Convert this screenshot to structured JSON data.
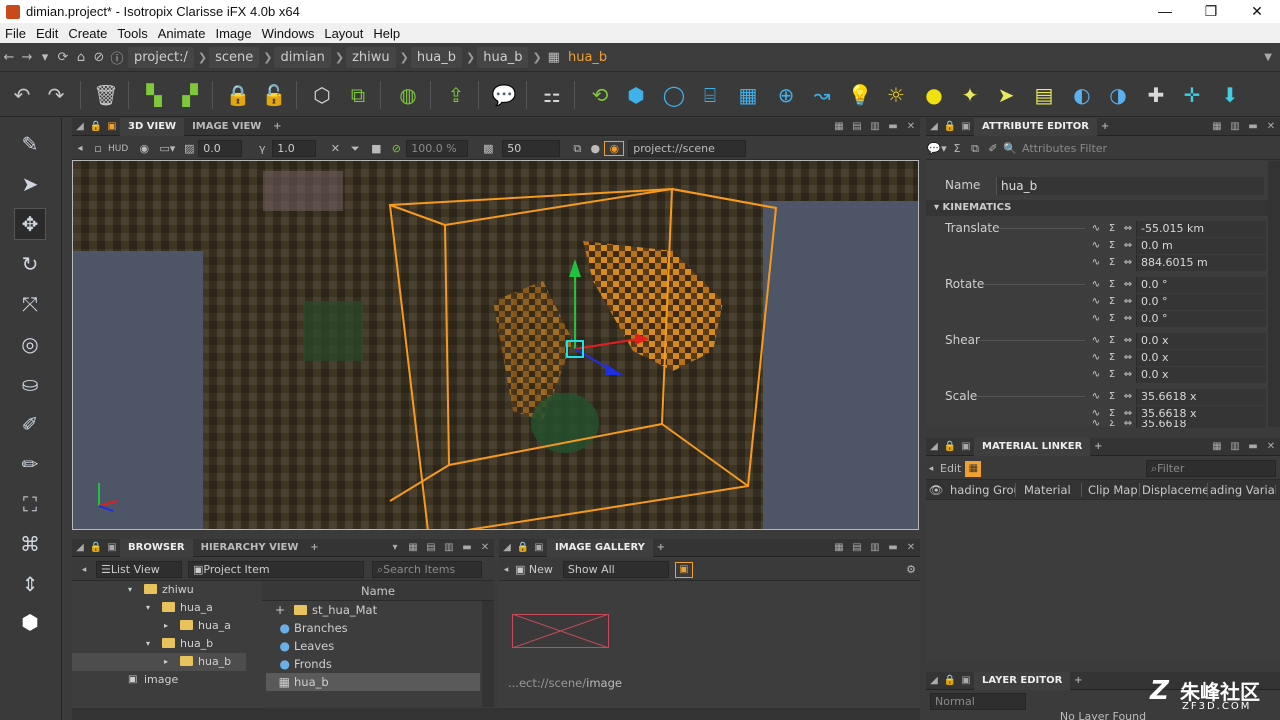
{
  "window": {
    "title": "dimian.project* - Isotropix Clarisse iFX 4.0b x64",
    "minimize": "—",
    "restore": "❐",
    "close": "✕"
  },
  "menu": [
    "File",
    "Edit",
    "Create",
    "Tools",
    "Animate",
    "Image",
    "Windows",
    "Layout",
    "Help"
  ],
  "path": {
    "crumbs": [
      "project:/",
      "scene",
      "dimian",
      "zhiwu",
      "hua_b",
      "hua_b"
    ],
    "current": "hua_b"
  },
  "viewport_panel": {
    "tabs": [
      "3D VIEW",
      "IMAGE VIEW"
    ],
    "hud_label": "HUD",
    "exposure": "0.0",
    "gamma_icon": "γ",
    "gamma": "1.0",
    "quality": "100.0 %",
    "samples": "50",
    "context": "project://scene"
  },
  "attribute_editor": {
    "tab": "ATTRIBUTE EDITOR",
    "filter_placeholder": "Attributes Filter",
    "name_label": "Name",
    "name_value": "hua_b",
    "section": "KINEMATICS",
    "translate_label": "Translate",
    "translate": [
      "-55.015 km",
      "0.0 m",
      "884.6015 m"
    ],
    "rotate_label": "Rotate",
    "rotate": [
      "0.0 °",
      "0.0 °",
      "0.0 °"
    ],
    "shear_label": "Shear",
    "shear": [
      "0.0 x",
      "0.0 x",
      "0.0 x"
    ],
    "scale_label": "Scale",
    "scale": [
      "35.6618 x",
      "35.6618 x",
      "35.6618"
    ]
  },
  "material_linker": {
    "tab": "MATERIAL LINKER",
    "edit_label": "Edit",
    "filter_placeholder": "Filter",
    "columns": [
      "hading Grou",
      "Material",
      "Clip Map",
      "Displacemen",
      "ading Variab"
    ]
  },
  "layer_editor": {
    "tab": "LAYER EDITOR",
    "mode": "Normal",
    "empty": "No Layer Found"
  },
  "browser": {
    "tabs": [
      "BROWSER",
      "HIERARCHY VIEW"
    ],
    "view_mode": "List View",
    "item_type": "Project Item",
    "search_placeholder": "Search Items",
    "name_header": "Name",
    "tree": [
      "zhiwu",
      "hua_a",
      "hua_a",
      "hua_b",
      "hua_b",
      "image"
    ],
    "items": [
      "st_hua_Mat",
      "Branches",
      "Leaves",
      "Fronds",
      "hua_b"
    ]
  },
  "image_gallery": {
    "tab": "IMAGE GALLERY",
    "new_label": "New",
    "filter": "Show All",
    "caption_prefix": "...ect://scene/",
    "caption": "image"
  },
  "watermark": {
    "text": "朱峰社区",
    "sub": "ZF3D.COM"
  },
  "colors": {
    "accent": "#f0a030",
    "selection": "#f59a1e",
    "panel": "#3a3a3a"
  }
}
